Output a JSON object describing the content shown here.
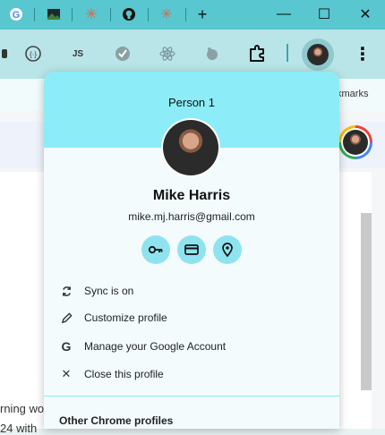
{
  "window": {
    "tabs": [
      {
        "icon": "google-g-icon"
      },
      {
        "icon": "image-tab-icon"
      },
      {
        "icon": "claude-asterisk-icon"
      },
      {
        "icon": "github-icon"
      },
      {
        "icon": "claude-asterisk-icon"
      }
    ],
    "new_tab_glyph": "+",
    "minimize_glyph": "—",
    "maximize_glyph": "☐",
    "close_glyph": "✕"
  },
  "toolbar": {
    "extension_js_label": "JS",
    "menu_glyph": "⋮"
  },
  "bookmarks": {
    "partial_label": "kmarks"
  },
  "page": {
    "snippet_line1": "rning wo",
    "snippet_line2": "24 with"
  },
  "profile_popup": {
    "header_title": "Person 1",
    "name": "Mike Harris",
    "email": "mike.mj.harris@gmail.com",
    "quick_actions": [
      {
        "icon": "key-icon"
      },
      {
        "icon": "credit-card-icon"
      },
      {
        "icon": "location-pin-icon"
      }
    ],
    "menu_items": [
      {
        "label": "Sync is on",
        "icon": "sync-icon"
      },
      {
        "label": "Customize profile",
        "icon": "pencil-icon"
      },
      {
        "label": "Manage your Google Account",
        "icon": "google-g-icon"
      },
      {
        "label": "Close this profile",
        "icon": "close-icon"
      }
    ],
    "other_profiles_heading": "Other Chrome profiles"
  },
  "colors": {
    "tabstrip": "#58c7cf",
    "toolbar": "#b9e5e8",
    "popup_header": "#8cecf7",
    "action_button": "#8fe3ee"
  }
}
